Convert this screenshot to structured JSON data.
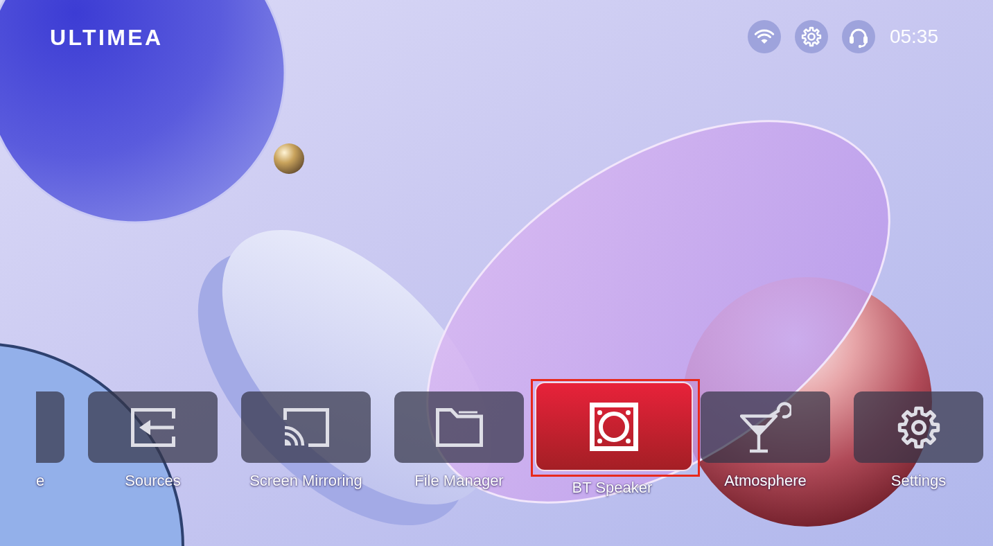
{
  "logo": "ULTIMEA",
  "status": {
    "time": "05:35"
  },
  "apps": [
    {
      "label": "e",
      "kind": "partial",
      "selected": false
    },
    {
      "label": "Sources",
      "kind": "input",
      "selected": false
    },
    {
      "label": "Screen Mirroring",
      "kind": "cast",
      "selected": false
    },
    {
      "label": "File Manager",
      "kind": "folder",
      "selected": false
    },
    {
      "label": "BT Speaker",
      "kind": "speaker",
      "selected": true
    },
    {
      "label": "Atmosphere",
      "kind": "cocktail",
      "selected": false
    },
    {
      "label": "Settings",
      "kind": "gear",
      "selected": false
    }
  ]
}
